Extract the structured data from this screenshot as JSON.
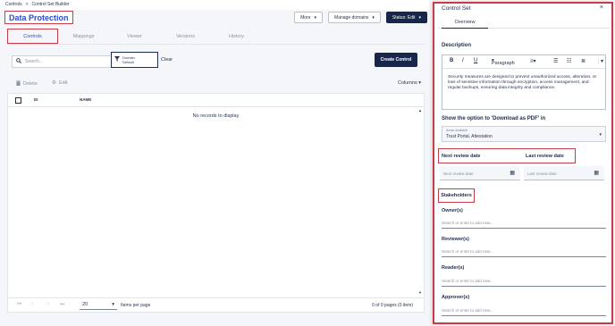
{
  "breadcrumb": {
    "root": "Controls",
    "sep": ">",
    "current": "Control Set Builder"
  },
  "page": {
    "title": "Data Protection"
  },
  "header_actions": {
    "more_label": "More",
    "manage_domains_label": "Manage domains",
    "status_label": "Status: Edit"
  },
  "tabs": [
    "Controls",
    "Mappings",
    "Viewer",
    "Versions",
    "History"
  ],
  "search": {
    "placeholder": "Search..."
  },
  "filter": {
    "name": "Domain",
    "value": "Default",
    "clear_label": "Clear"
  },
  "create_button": "Create Control",
  "actions": {
    "delete_label": "Delete",
    "edit_label": "Edit",
    "columns_label": "Columns"
  },
  "table": {
    "columns": [
      "ID",
      "NAME"
    ],
    "empty_message": "No records to display"
  },
  "pagination": {
    "page_size": "20",
    "per_page_label": "Items per page",
    "page_info": "0 of 0 pages (0 item)"
  },
  "panel": {
    "title": "Control Set",
    "tab": "Overview",
    "description_title": "Description",
    "editor_toolbar": {
      "bold": "B",
      "italic": "I",
      "underline": "U",
      "paragraph": "Paragraph"
    },
    "description_text": "Security measures are designed to prevent unauthorized access, alteration, or loss of sensitive information through encryption, access management, and regular backups, ensuring data integrity and compliance.",
    "pdf_option_title": "Show the option to 'Download as PDF' in",
    "pdf_select_label": "Areas available",
    "pdf_select_value": "Trust Portal, Attestation",
    "next_review_title": "Next review date",
    "last_review_title": "Last review date",
    "next_review_placeholder": "Next review date",
    "last_review_placeholder": "Last review date",
    "stakeholders_title": "Stakeholders",
    "roles": [
      {
        "label": "Owner(s)",
        "placeholder": "Search or enter to add new..."
      },
      {
        "label": "Reviewer(s)",
        "placeholder": "Search or enter to add new..."
      },
      {
        "label": "Reader(s)",
        "placeholder": "Search or enter to add new..."
      },
      {
        "label": "Approver(s)",
        "placeholder": "Search or enter to add new..."
      }
    ]
  },
  "colors": {
    "navy": "#17264a",
    "accent_blue": "#2b4bd6",
    "highlight_red": "#c63d4a"
  }
}
